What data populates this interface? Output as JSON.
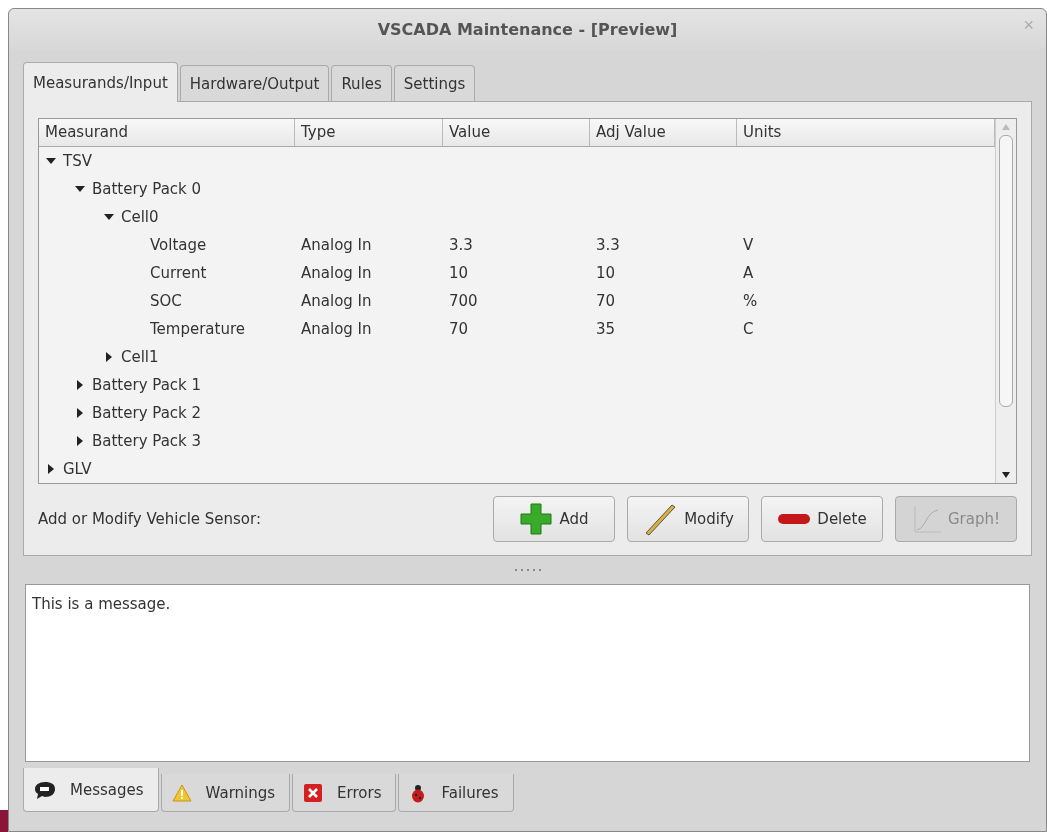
{
  "window": {
    "title": "VSCADA Maintenance - [Preview]",
    "close": "×"
  },
  "tabs": [
    {
      "label": "Measurands/Input",
      "selected": true
    },
    {
      "label": "Hardware/Output",
      "selected": false
    },
    {
      "label": "Rules",
      "selected": false
    },
    {
      "label": "Settings",
      "selected": false
    }
  ],
  "table": {
    "columns": [
      "Measurand",
      "Type",
      "Value",
      "Adj Value",
      "Units"
    ],
    "rows": [
      {
        "name": "TSV",
        "expanded": true,
        "children": [
          {
            "name": "Battery Pack 0",
            "expanded": true,
            "children": [
              {
                "name": "Cell0",
                "expanded": true,
                "children": [
                  {
                    "name": "Voltage",
                    "type": "Analog In",
                    "value": "3.3",
                    "adj_value": "3.3",
                    "units": "V"
                  },
                  {
                    "name": "Current",
                    "type": "Analog In",
                    "value": "10",
                    "adj_value": "10",
                    "units": "A"
                  },
                  {
                    "name": "SOC",
                    "type": "Analog In",
                    "value": "700",
                    "adj_value": "70",
                    "units": "%"
                  },
                  {
                    "name": "Temperature",
                    "type": "Analog In",
                    "value": "70",
                    "adj_value": "35",
                    "units": "C"
                  }
                ]
              },
              {
                "name": "Cell1",
                "expanded": false
              }
            ]
          },
          {
            "name": "Battery Pack 1",
            "expanded": false
          },
          {
            "name": "Battery Pack 2",
            "expanded": false
          },
          {
            "name": "Battery Pack 3",
            "expanded": false
          }
        ]
      },
      {
        "name": "GLV",
        "expanded": false
      }
    ]
  },
  "action_label": "Add or Modify Vehicle Sensor:",
  "buttons": [
    {
      "kind": "add",
      "label": "Add",
      "disabled": false
    },
    {
      "kind": "modify",
      "label": "Modify",
      "disabled": false
    },
    {
      "kind": "delete",
      "label": "Delete",
      "disabled": false
    },
    {
      "kind": "graph",
      "label": "Graph!",
      "disabled": true
    }
  ],
  "message": "This is a message.",
  "bottom_tabs": [
    {
      "kind": "messages",
      "label": "Messages",
      "selected": true
    },
    {
      "kind": "warnings",
      "label": "Warnings",
      "selected": false
    },
    {
      "kind": "errors",
      "label": "Errors",
      "selected": false
    },
    {
      "kind": "failures",
      "label": "Failures",
      "selected": false
    }
  ]
}
